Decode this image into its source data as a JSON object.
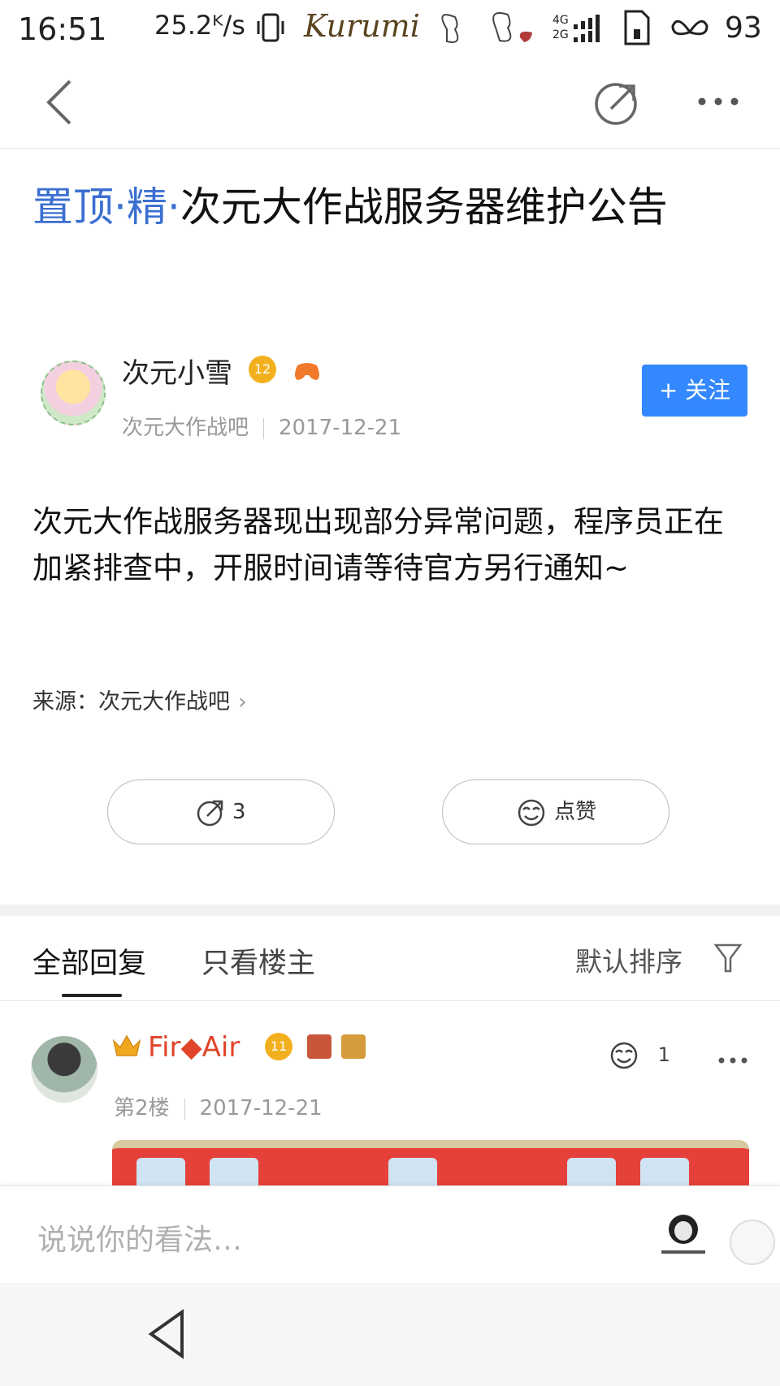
{
  "status_bar": {
    "time": "16:51",
    "speed": "25.2ᴷ/s",
    "brand": "Kurumi",
    "net_top": "4G",
    "net_bottom": "2G",
    "battery": "93"
  },
  "nav": {
    "back_icon": "chevron-left-icon",
    "share_icon": "share-icon",
    "more_icon": "more-icon"
  },
  "post": {
    "tag_pinned": "置顶",
    "tag_elite": "精",
    "title": "次元大作战服务器维护公告",
    "author_name": "次元小雪",
    "author_level": "12",
    "forum": "次元大作战吧",
    "date": "2017-12-21",
    "follow_label": "+ 关注",
    "body": "次元大作战服务器现出现部分异常问题，程序员正在加紧排查中，开服时间请等待官方另行通知~",
    "source_label": "来源：",
    "source_value": "次元大作战吧",
    "share_count": "3",
    "like_label": "点赞"
  },
  "tabs": {
    "all_replies": "全部回复",
    "owner_only": "只看楼主",
    "sort_label": "默认排序"
  },
  "reply": {
    "user_name": "Fir◆Air",
    "user_level": "11",
    "floor": "第2楼",
    "date": "2017-12-21",
    "like_count": "1"
  },
  "input": {
    "placeholder": "说说你的看法…"
  },
  "colors": {
    "tag_blue": "#3b6fd1",
    "follow_blue": "#3388ff",
    "reply_name": "#e0452a",
    "badge_gold": "#f2b01e"
  }
}
